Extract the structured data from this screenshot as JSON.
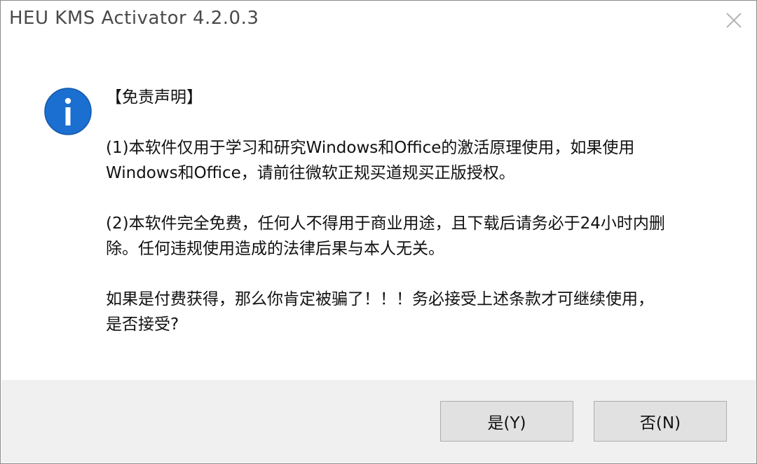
{
  "window": {
    "title": "HEU KMS Activator 4.2.0.3"
  },
  "message": {
    "heading": "【免责声明】",
    "para1_line1": "(1)本软件仅用于学习和研究Windows和Office的激活原理使用，如果使用",
    "para1_line2": "Windows和Office，请前往微软正规买道规买正版授权。",
    "para2_line1": "(2)本软件完全免费，任何人不得用于商业用途，且下载后请务必于24小时内删",
    "para2_line2": "除。任何违规使用造成的法律后果与本人无关。",
    "para3_line1": "如果是付费获得，那么你肯定被骗了！！！务必接受上述条款才可继续使用，",
    "para3_line2": "是否接受?"
  },
  "buttons": {
    "yes_label": "是(Y)",
    "no_label": "否(N)"
  },
  "icons": {
    "info": "info-icon",
    "close": "close-icon"
  },
  "colors": {
    "info_icon_fill": "#1a6fd0",
    "footer_background": "#f0f0f0",
    "button_background": "#e1e1e1"
  }
}
